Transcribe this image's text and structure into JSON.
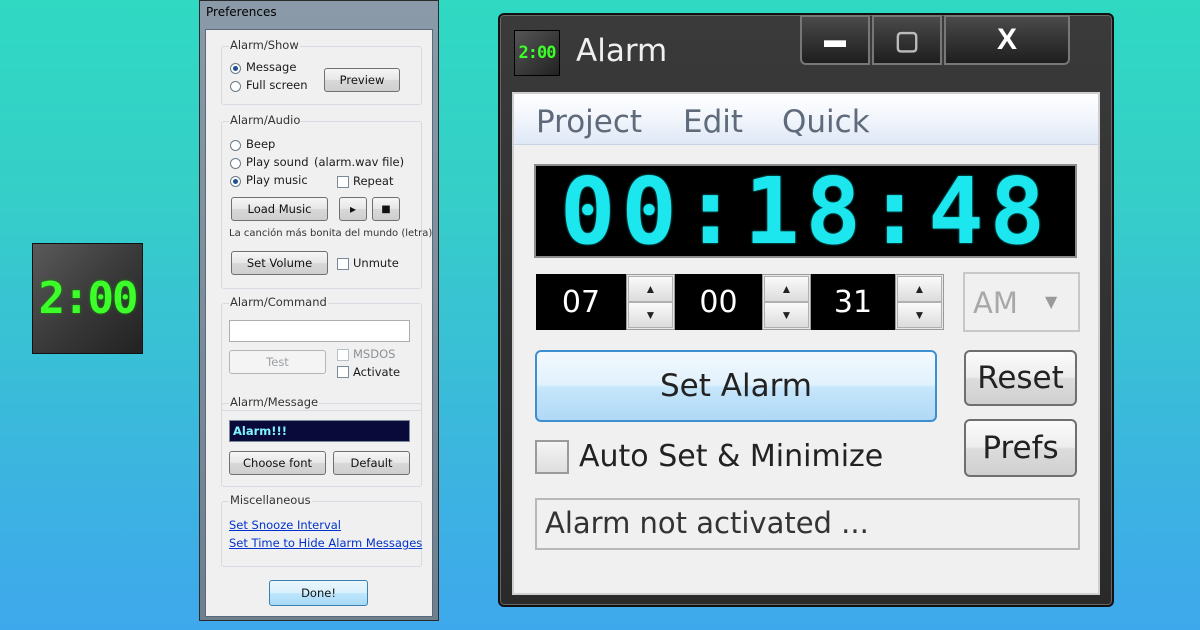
{
  "desktop": {
    "icon_text": "2:00"
  },
  "preferences": {
    "title": "Preferences",
    "alarm_show": {
      "title": "Alarm/Show",
      "message_label": "Message",
      "fullscreen_label": "Full screen",
      "selected": "Message",
      "preview_label": "Preview"
    },
    "alarm_audio": {
      "title": "Alarm/Audio",
      "beep_label": "Beep",
      "play_sound_label": "Play sound",
      "sound_file_label": "(alarm.wav file)",
      "play_music_label": "Play music",
      "selected": "Play music",
      "repeat_label": "Repeat",
      "load_music_label": "Load Music",
      "play_glyph": "▸",
      "stop_glyph": "■",
      "music_name": "La canción más bonita del mundo (letra)",
      "set_volume_label": "Set Volume",
      "unmute_label": "Unmute"
    },
    "alarm_command": {
      "title": "Alarm/Command",
      "command_value": "",
      "test_label": "Test",
      "msdos_label": "MSDOS",
      "activate_label": "Activate"
    },
    "alarm_message": {
      "title": "Alarm/Message",
      "message_value": "Alarm!!!",
      "choose_font_label": "Choose font",
      "default_label": "Default"
    },
    "misc": {
      "title": "Miscellaneous",
      "snooze_link": "Set Snooze Interval",
      "hide_link": "Set Time to Hide Alarm Messages"
    },
    "done_label": "Done!"
  },
  "alarm": {
    "logo_text": "2:00",
    "title": "Alarm",
    "window_buttons": {
      "minimize": "▬",
      "maximize": "▢",
      "close": "X"
    },
    "menu": {
      "project": "Project",
      "edit": "Edit",
      "quick": "Quick"
    },
    "display_time": "00:18:48",
    "hours": "07",
    "minutes": "00",
    "seconds": "31",
    "spin_up": "▲",
    "spin_down": "▼",
    "ampm": "AM",
    "dropdown_arrow": "▼",
    "set_alarm_label": "Set Alarm",
    "reset_label": "Reset",
    "prefs_label": "Prefs",
    "auto_set_label": "Auto Set & Minimize",
    "status_text": "Alarm not activated ..."
  },
  "colors": {
    "lcd_digits": "#1ce6ee",
    "logo_digits": "#3cff2a",
    "message_bg": "#0a0a3a"
  }
}
